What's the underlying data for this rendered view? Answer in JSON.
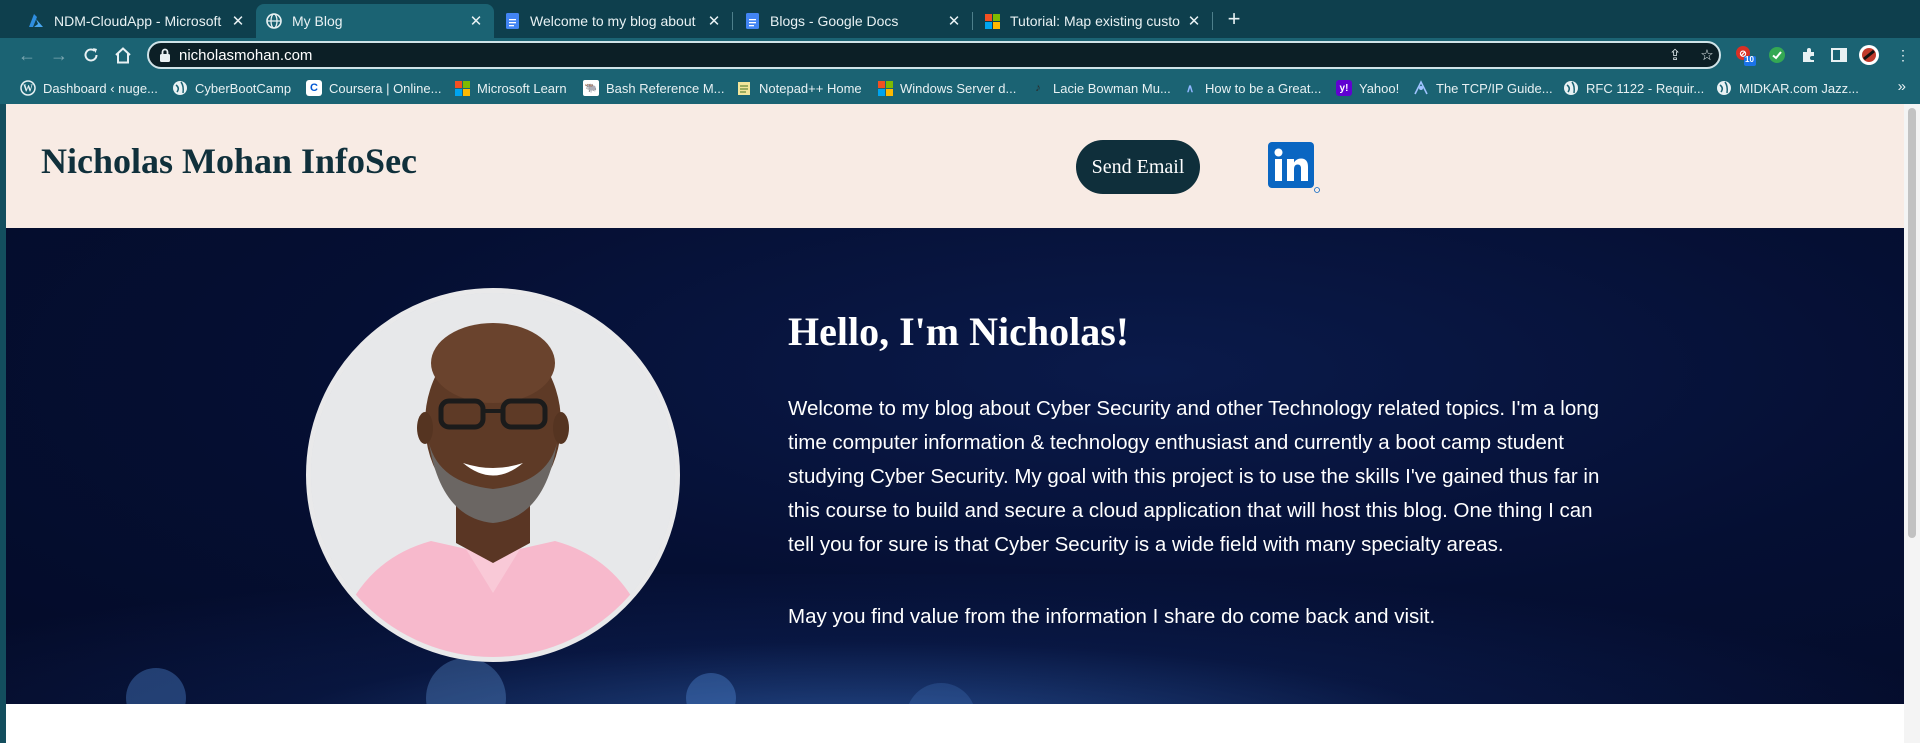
{
  "tabs": [
    {
      "title": "NDM-CloudApp - Microsoft Az",
      "icon": "azure-icon",
      "active": false
    },
    {
      "title": "My Blog",
      "icon": "globe-icon",
      "active": true
    },
    {
      "title": "Welcome to my blog about Cyb",
      "icon": "google-docs-icon",
      "active": false
    },
    {
      "title": "Blogs - Google Docs",
      "icon": "google-docs-icon",
      "active": false
    },
    {
      "title": "Tutorial: Map existing custom D",
      "icon": "microsoft-icon",
      "active": false
    }
  ],
  "toolbar": {
    "url": "nicholasmohan.com",
    "extension_badge": "10"
  },
  "bookmarks": [
    {
      "label": "Dashboard ‹ nuge...",
      "icon": "wordpress-icon"
    },
    {
      "label": "CyberBootCamp",
      "icon": "globe-icon"
    },
    {
      "label": "Coursera | Online...",
      "icon": "coursera-icon"
    },
    {
      "label": "Microsoft Learn",
      "icon": "microsoft-icon"
    },
    {
      "label": "Bash Reference M...",
      "icon": "gnu-icon"
    },
    {
      "label": "Notepad++ Home",
      "icon": "notepad-icon"
    },
    {
      "label": "Windows Server d...",
      "icon": "microsoft-icon"
    },
    {
      "label": "Lacie Bowman Mu...",
      "icon": "music-icon"
    },
    {
      "label": "How to be a Great...",
      "icon": "feather-icon"
    },
    {
      "label": "Yahoo!",
      "icon": "yahoo-icon"
    },
    {
      "label": "The TCP/IP Guide...",
      "icon": "network-icon"
    },
    {
      "label": "RFC 1122 - Requir...",
      "icon": "globe-icon"
    },
    {
      "label": "MIDKAR.com Jazz...",
      "icon": "globe-icon"
    }
  ],
  "site": {
    "title": "Nicholas Mohan InfoSec",
    "email_button": "Send Email",
    "linkedin_text": "in",
    "hello": "Hello, I'm Nicholas!",
    "intro": "Welcome to my blog about Cyber Security and other Technology related topics. I'm a long time computer information & technology enthusiast and currently a boot camp student studying Cyber Security. My goal with this project is to use the skills I've gained thus far in this course to build and secure a cloud application that will host this blog. One thing I can tell you for sure is that Cyber Security is a wide field with many specialty areas.",
    "outro": "May you find value from the information I share do come back and visit."
  },
  "colors": {
    "header_bg": "#f8ebe4",
    "hero_bg": "#050f33",
    "title_color": "#10303b",
    "button_bg": "#0f2f3b",
    "linkedin_blue": "#0a66c2",
    "browser_frame": "#1b6373"
  }
}
